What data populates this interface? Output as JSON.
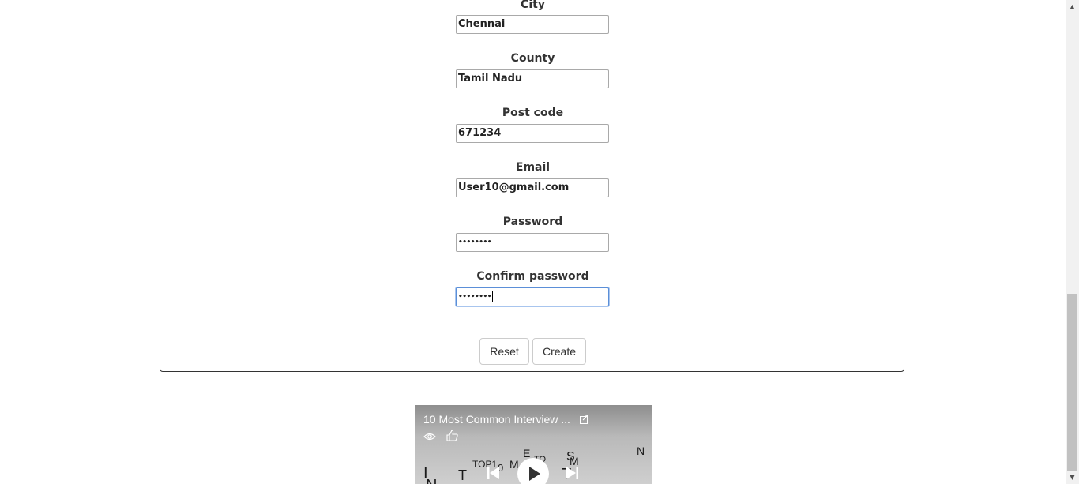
{
  "form": {
    "fields": [
      {
        "label": "City",
        "value": "Chennai"
      },
      {
        "label": "County",
        "value": "Tamil Nadu"
      },
      {
        "label": "Post code",
        "value": "671234"
      },
      {
        "label": "Email",
        "value": "User10@gmail.com"
      },
      {
        "label": "Password",
        "value": "••••••••"
      },
      {
        "label": "Confirm password",
        "value": "••••••••"
      }
    ],
    "reset_label": "Reset",
    "create_label": "Create"
  },
  "video": {
    "title": "10 Most Common Interview ..."
  },
  "colors": {
    "border": "#333333",
    "focus": "#5b8fd8",
    "video_bg": "#b0b0b0"
  }
}
